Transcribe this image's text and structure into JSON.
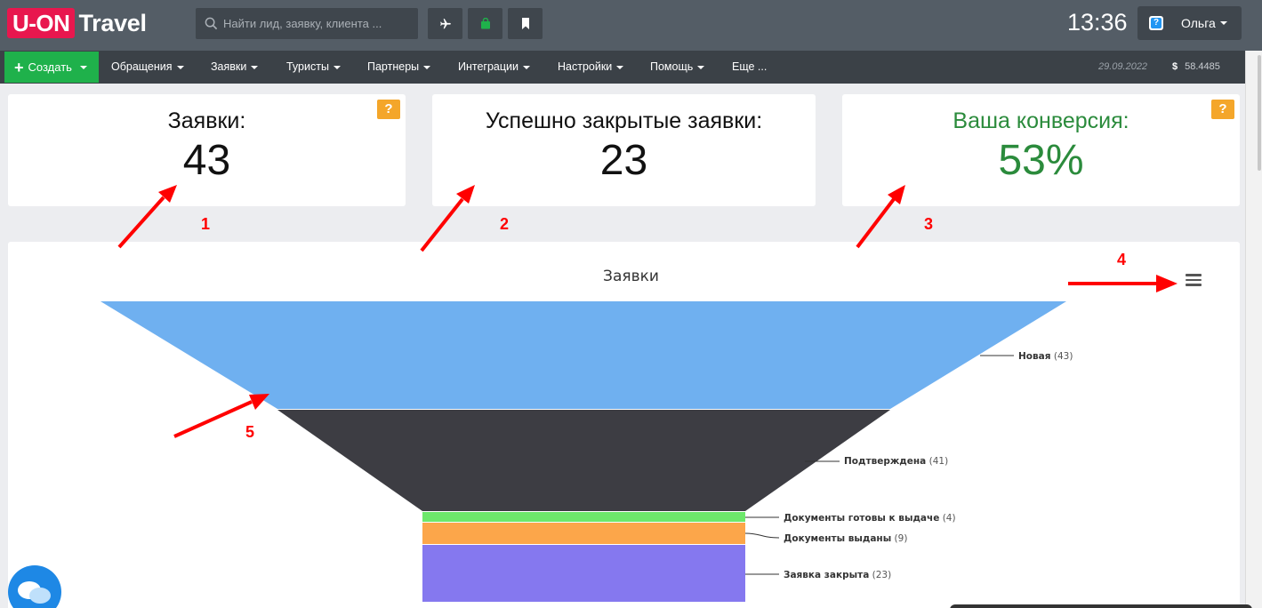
{
  "app": {
    "logo_box": "U-ON",
    "logo_text": "Travel"
  },
  "search": {
    "placeholder": "Найти лид, заявку, клиента ..."
  },
  "toolbar": {
    "icons": [
      "airplane-icon",
      "bag-icon",
      "bookmark-icon"
    ]
  },
  "clock": "13:36",
  "user": {
    "name": "Ольга"
  },
  "nav": {
    "create_label": "Создать",
    "items": [
      "Обращения",
      "Заявки",
      "Туристы",
      "Партнеры",
      "Интеграции",
      "Настройки",
      "Помощь",
      "Еще ..."
    ],
    "date": "29.09.2022",
    "currency_symbol": "$",
    "rate": "58.4485"
  },
  "cards": [
    {
      "title": "Заявки:",
      "value": "43",
      "help": "?"
    },
    {
      "title": "Успешно закрытые заявки:",
      "value": "23"
    },
    {
      "title": "Ваша конверсия:",
      "value": "53%",
      "help": "?"
    }
  ],
  "annotations": [
    "1",
    "2",
    "3",
    "4",
    "5"
  ],
  "colors": {
    "accent_green": "#1fb14b",
    "conversion_green": "#2b8b3c",
    "brand_red": "#e8174e",
    "help_orange": "#f4a62a",
    "annotation_red": "#ff0000"
  },
  "chart_data": {
    "type": "funnel",
    "title": "Заявки",
    "categories": [
      "Новая",
      "Подтверждена",
      "Документы готовы к выдаче",
      "Документы выданы",
      "Заявка закрыта"
    ],
    "values": [
      43,
      41,
      4,
      9,
      23
    ],
    "colors": [
      "#6fb0f0",
      "#3d3d43",
      "#6de86b",
      "#fca64a",
      "#8578ef"
    ],
    "legend": "none"
  }
}
